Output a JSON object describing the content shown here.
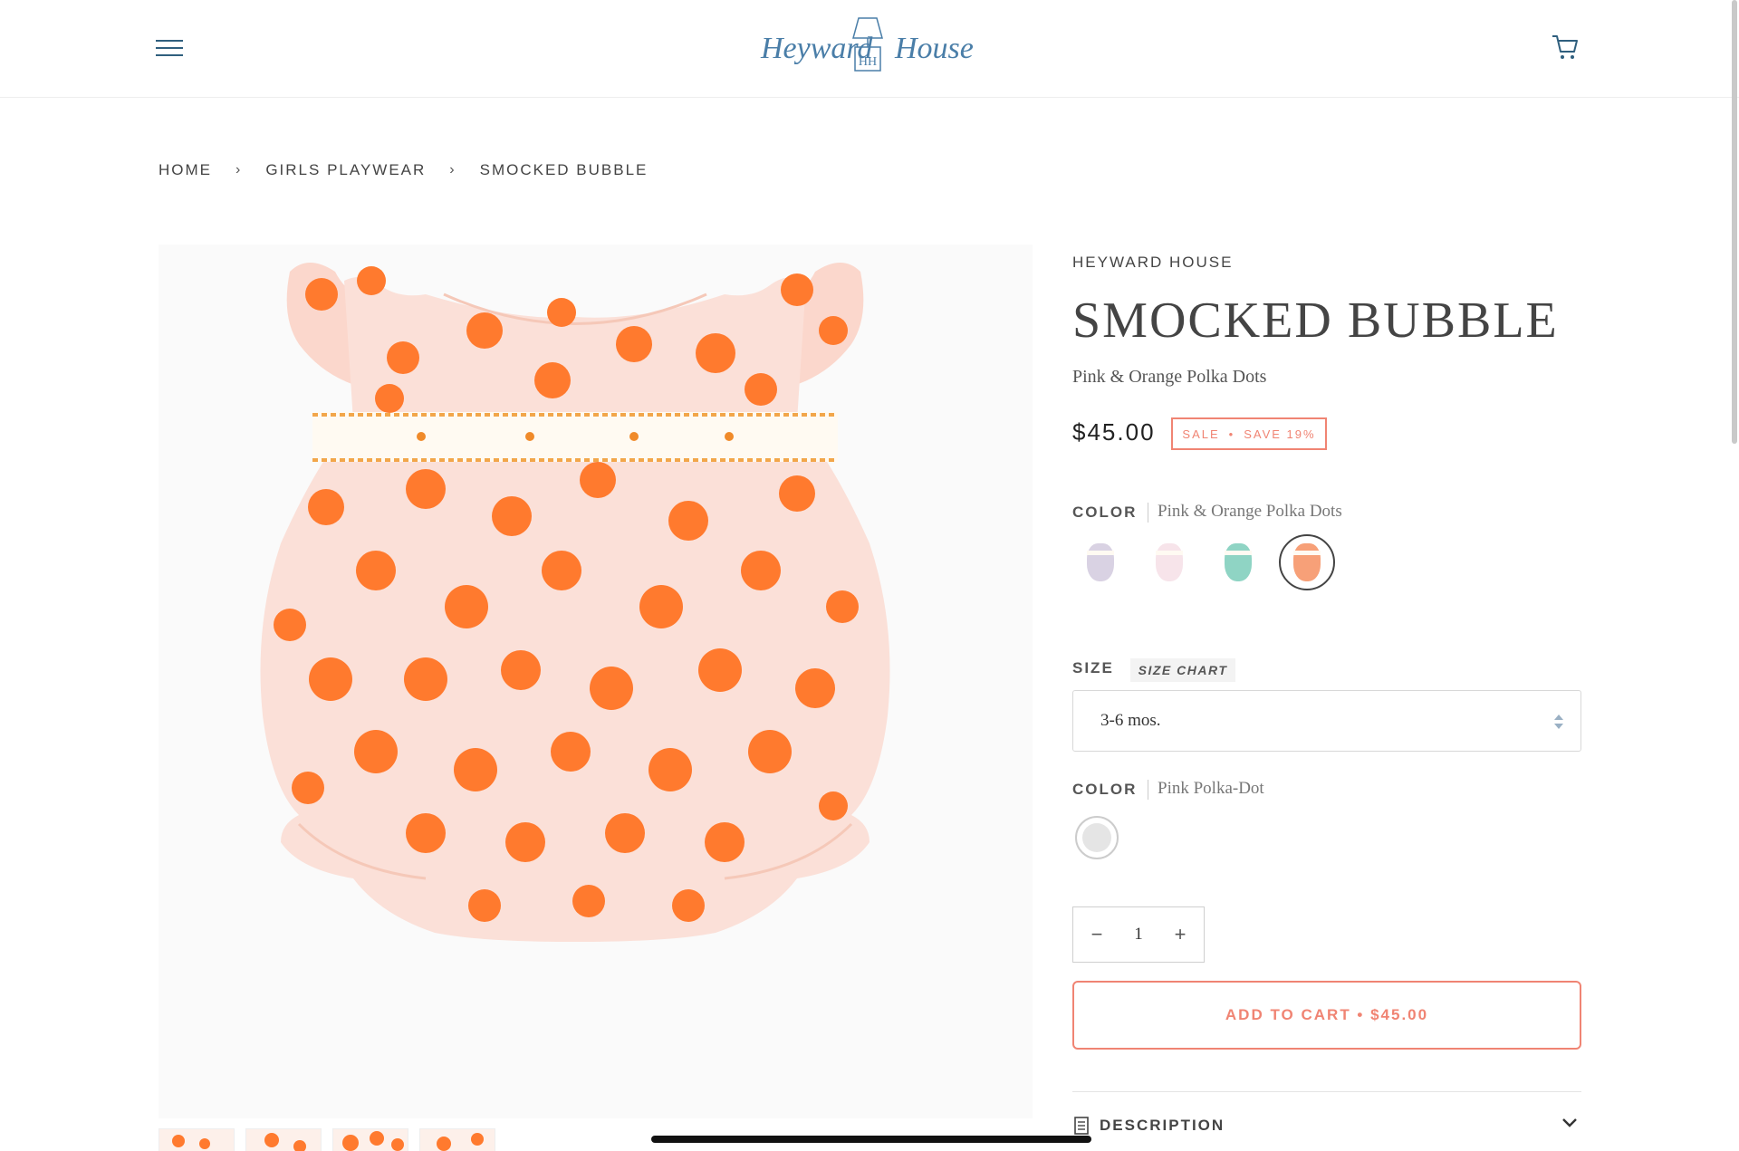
{
  "header": {
    "menu_icon": "hamburger-menu-icon",
    "logo_text": "Heyward House",
    "logo_monogram": "HH",
    "cart_icon": "shopping-cart-icon"
  },
  "breadcrumb": {
    "items": [
      "HOME",
      "GIRLS PLAYWEAR",
      "SMOCKED BUBBLE"
    ],
    "separator": "›"
  },
  "product": {
    "vendor": "HEYWARD HOUSE",
    "title": "SMOCKED BUBBLE",
    "subtitle": "Pink & Orange Polka Dots",
    "price": "$45.00",
    "sale_badge": {
      "sale": "SALE",
      "bullet": "•",
      "save": "SAVE 19%"
    },
    "colors": {
      "primary": "#f08473",
      "dot_orange": "#ff7a2e",
      "fabric_pink": "#fbe0d8"
    }
  },
  "options": {
    "color": {
      "label": "COLOR",
      "value": "Pink & Orange Polka Dots",
      "swatches": [
        {
          "name": "lavender",
          "color": "#d9d2e3"
        },
        {
          "name": "pink-print",
          "color": "#f7e4ea"
        },
        {
          "name": "mint",
          "color": "#8fd4c4"
        },
        {
          "name": "orange-dots",
          "color": "#f7a078",
          "selected": true
        }
      ]
    },
    "size": {
      "label": "SIZE",
      "size_chart": "SIZE CHART",
      "selected": "3-6 mos."
    },
    "color2": {
      "label": "COLOR",
      "value": "Pink Polka-Dot"
    }
  },
  "quantity": {
    "minus": "−",
    "value": "1",
    "plus": "+"
  },
  "add_to_cart": {
    "label": "ADD TO CART • $45.00"
  },
  "description": {
    "label": "DESCRIPTION",
    "icon": "description-icon",
    "chevron": "chevron-down-icon"
  }
}
